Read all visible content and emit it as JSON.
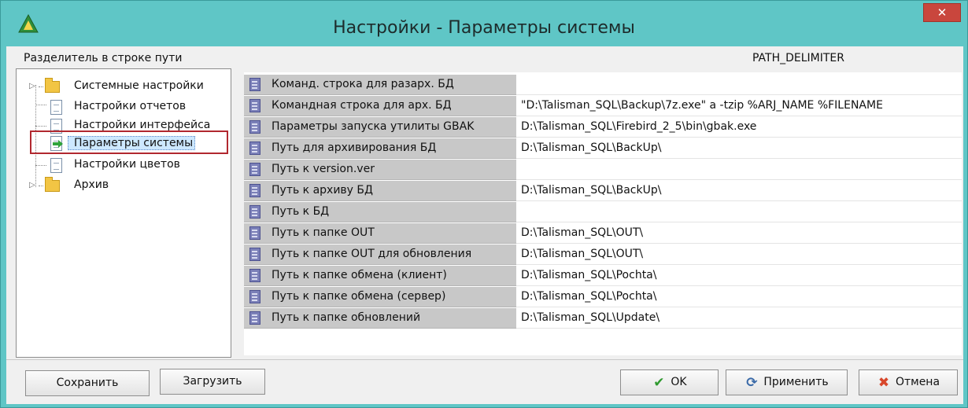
{
  "window": {
    "title": "Настройки - Параметры системы",
    "close_label": "✕"
  },
  "description": {
    "label": "Разделитель в строке пути",
    "code": "PATH_DELIMITER"
  },
  "tree": {
    "items": [
      {
        "label": "Системные настройки",
        "icon": "folder-icon",
        "expandable": true
      },
      {
        "label": "Настройки отчетов",
        "icon": "document-icon"
      },
      {
        "label": "Настройки интерфейса",
        "icon": "document-icon"
      },
      {
        "label": "Параметры системы",
        "icon": "document-arrow-icon",
        "selected": true
      },
      {
        "label": "Настройки цветов",
        "icon": "document-icon"
      },
      {
        "label": "Архив",
        "icon": "folder-icon",
        "expandable": true
      }
    ]
  },
  "params": [
    {
      "name": "Команд. строка для разарх. БД",
      "value": ""
    },
    {
      "name": "Командная строка для арх. БД",
      "value": "\"D:\\Talisman_SQL\\Backup\\7z.exe\" a -tzip %ARJ_NAME %FILENAME"
    },
    {
      "name": "Параметры запуска утилиты GBAK",
      "value": "D:\\Talisman_SQL\\Firebird_2_5\\bin\\gbak.exe"
    },
    {
      "name": "Путь для архивирования БД",
      "value": "D:\\Talisman_SQL\\BackUp\\"
    },
    {
      "name": "Путь к version.ver",
      "value": ""
    },
    {
      "name": "Путь к архиву БД",
      "value": "D:\\Talisman_SQL\\BackUp\\"
    },
    {
      "name": "Путь к БД",
      "value": ""
    },
    {
      "name": "Путь к папке OUT",
      "value": "D:\\Talisman_SQL\\OUT\\"
    },
    {
      "name": "Путь к папке OUT для обновления",
      "value": "D:\\Talisman_SQL\\OUT\\"
    },
    {
      "name": "Путь к папке обмена (клиент)",
      "value": "D:\\Talisman_SQL\\Pochta\\"
    },
    {
      "name": "Путь к папке обмена (сервер)",
      "value": "D:\\Talisman_SQL\\Pochta\\"
    },
    {
      "name": "Путь к папке обновлений",
      "value": "D:\\Talisman_SQL\\Update\\"
    }
  ],
  "buttons": {
    "save": "Сохранить",
    "load": "Загрузить",
    "ok": "OK",
    "apply": "Применить",
    "cancel": "Отмена"
  },
  "colors": {
    "titlebar": "#5fc6c6",
    "close": "#c9463d",
    "selection_outline": "#b1282f"
  }
}
